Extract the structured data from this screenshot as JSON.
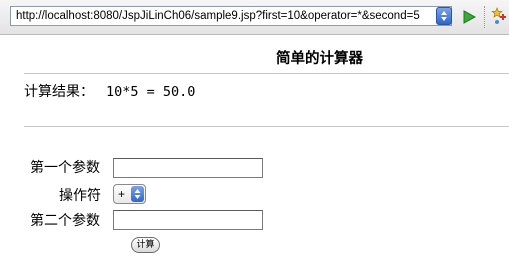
{
  "browser": {
    "url": "http://localhost:8080/JspJiLinCh06/sample9.jsp?first=10&operator=*&second=5"
  },
  "page": {
    "title": "简单的计算器",
    "result_label": "计算结果：",
    "result_value": "10*5 = 50.0"
  },
  "form": {
    "first_label": "第一个参数",
    "first_value": "",
    "operator_label": "操作符",
    "operator_value": "+",
    "second_label": "第二个参数",
    "second_value": "",
    "submit_label": "计算"
  },
  "colors": {
    "accent": "#2f67c9",
    "go_green": "#3aa83a"
  },
  "icons": [
    "url-dropdown-icon",
    "go-arrow-icon",
    "addon-star-icon",
    "select-arrow-icon"
  ]
}
